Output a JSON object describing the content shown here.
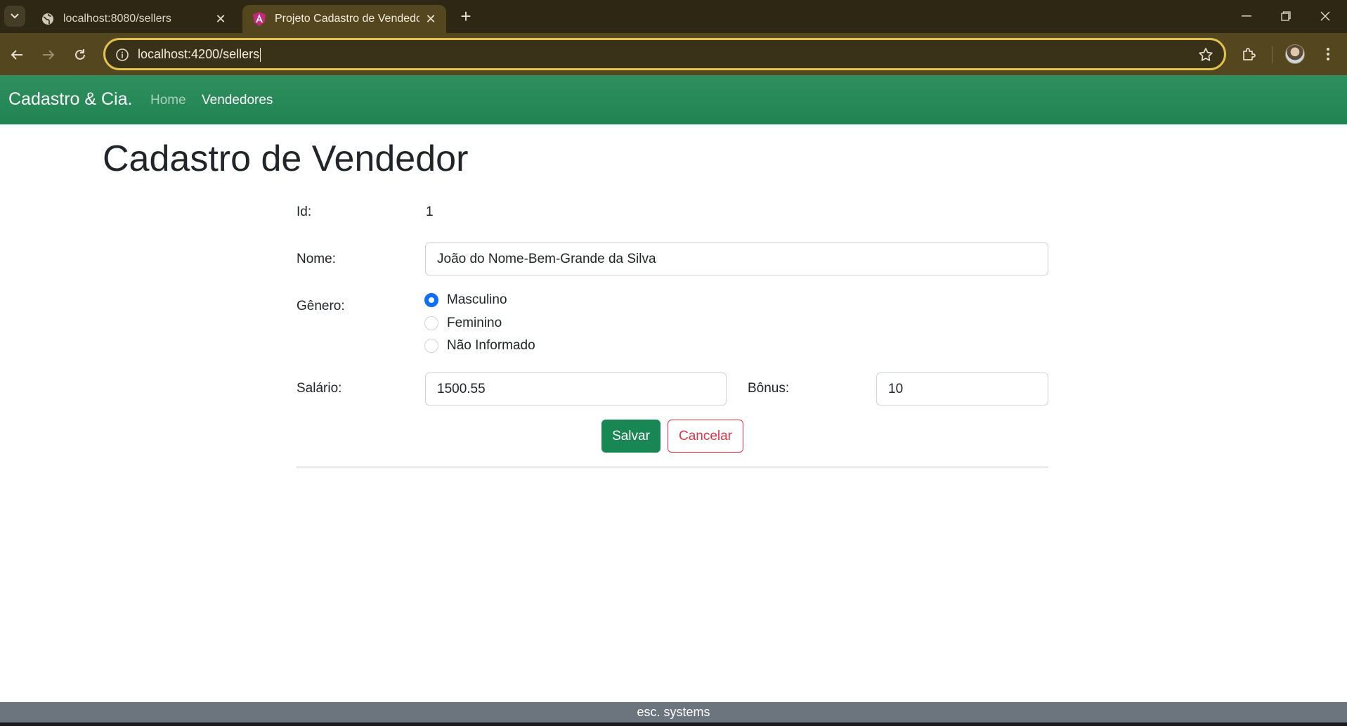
{
  "browser": {
    "tabs": [
      {
        "title": "localhost:8080/sellers",
        "icon": "globe-icon",
        "active": false
      },
      {
        "title": "Projeto Cadastro de Vendedores",
        "icon": "angular-icon",
        "active": true
      }
    ],
    "url": "localhost:4200/sellers",
    "accent_color": "#e3c24d"
  },
  "navbar": {
    "brand": "Cadastro & Cia.",
    "links": [
      {
        "label": "Home",
        "active": false
      },
      {
        "label": "Vendedores",
        "active": true
      }
    ],
    "color": "#218352"
  },
  "form": {
    "title": "Cadastro de Vendedor",
    "id_label": "Id:",
    "id_value": "1",
    "name_label": "Nome:",
    "name_value": "João do Nome-Bem-Grande da Silva",
    "gender_label": "Gênero:",
    "gender_options": [
      {
        "label": "Masculino",
        "checked": true
      },
      {
        "label": "Feminino",
        "checked": false
      },
      {
        "label": "Não Informado",
        "checked": false
      }
    ],
    "salary_label": "Salário:",
    "salary_value": "1500.55",
    "bonus_label": "Bônus:",
    "bonus_value": "10",
    "save_label": "Salvar",
    "cancel_label": "Cancelar"
  },
  "footer": {
    "text": "esc. systems"
  }
}
